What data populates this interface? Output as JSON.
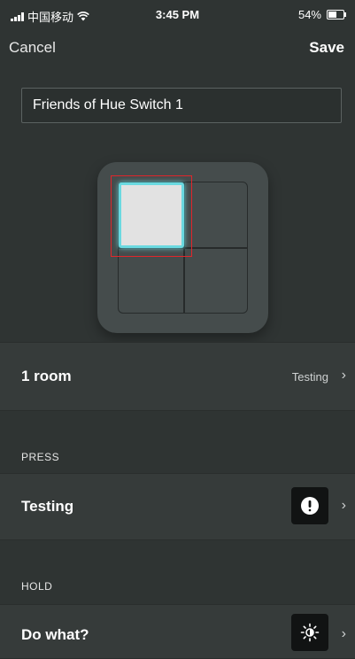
{
  "status_bar": {
    "carrier": "中国移动",
    "time": "3:45 PM",
    "battery": "54%",
    "battery_level": 0.54,
    "icons": [
      "signal-icon",
      "wifi-icon",
      "battery-icon"
    ]
  },
  "nav": {
    "cancel_label": "Cancel",
    "save_label": "Save"
  },
  "name_field": {
    "value": "Friends of Hue Switch 1"
  },
  "switch": {
    "selected_button": "top-left",
    "colors": {
      "selected_fill": "#e2e2e2",
      "selected_glow": "#6ad9e0",
      "highlight": "#e0262b"
    }
  },
  "room_row": {
    "title": "1 room",
    "value": "Testing"
  },
  "press_section": {
    "label": "PRESS",
    "title": "Testing",
    "icon": "power-icon"
  },
  "hold_section": {
    "label": "HOLD",
    "title": "Do what?",
    "icon": "brightness-icon"
  }
}
